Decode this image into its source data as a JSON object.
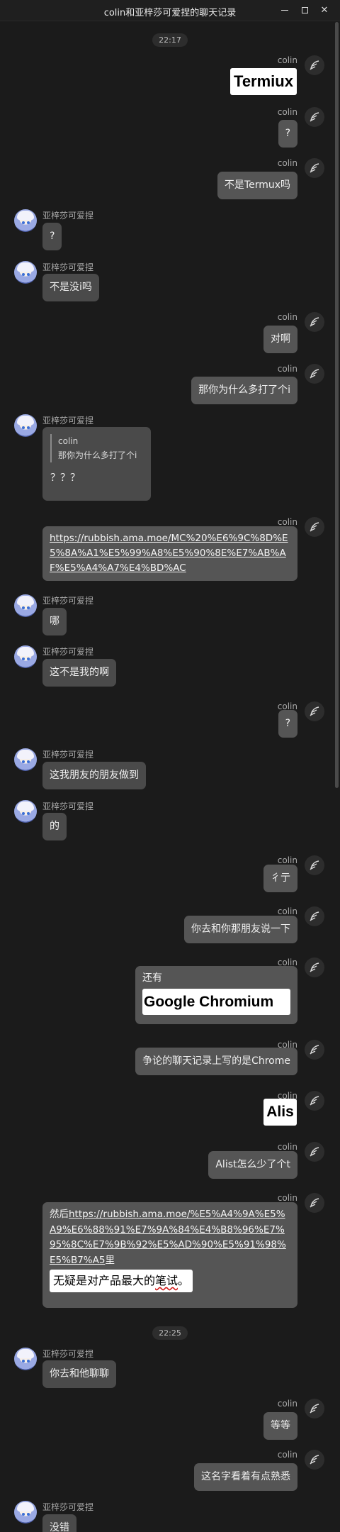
{
  "window": {
    "title": "colin和亚梓莎可爱捏的聊天记录"
  },
  "users": {
    "me": "colin",
    "peer": "亚梓莎可爱捏"
  },
  "timestamps": [
    "22:17",
    "22:25"
  ],
  "messages": {
    "m1": "Termiux",
    "m2": "?",
    "m3": "不是Termux吗",
    "m4": "?",
    "m5": "不是没i吗",
    "m6": "对啊",
    "m7": "那你为什么多打了个i",
    "m8_quote_name": "colin",
    "m8_quote_text": "那你为什么多打了个i",
    "m8_text": "？？？",
    "m9": "https://rubbish.ama.moe/MC%20%E6%9C%8D%E5%8A%A1%E5%99%A8%E5%90%8E%E7%AB%AF%E5%A4%A7%E4%BD%AC",
    "m10": "哪",
    "m11": "这不是我的啊",
    "m12": "?",
    "m13": "这我朋友的朋友做到",
    "m14": "的",
    "m15": "彳亍",
    "m16": "你去和你那朋友说一下",
    "m17_text": "还有",
    "m17_sticker": "Google Chromium",
    "m18": "争论的聊天记录上写的是Chrome",
    "m19": "Alis",
    "m20": "Alist怎么少了个t",
    "m21_prefix": "然后",
    "m21_link": "https://rubbish.ama.moe/%E5%A4%9A%E5%A9%E6%88%91%E7%9A%84%E4%B8%96%E7%95%8C%E7%9B%92%E5%AD%90%E5%91%98%E5%B7%A5",
    "m21_suffix": "里",
    "m21_img_text_a": "无疑是对产品最大的",
    "m21_img_text_b": "笔试",
    "m21_img_text_c": "。",
    "m22": "你去和他聊聊",
    "m23": "等等",
    "m24": "这名字看着有点熟悉",
    "m25": "没错"
  },
  "colors": {
    "background": "#1b1b1b",
    "bubble": "#4a4a4a",
    "name": "#a9a9a9"
  }
}
